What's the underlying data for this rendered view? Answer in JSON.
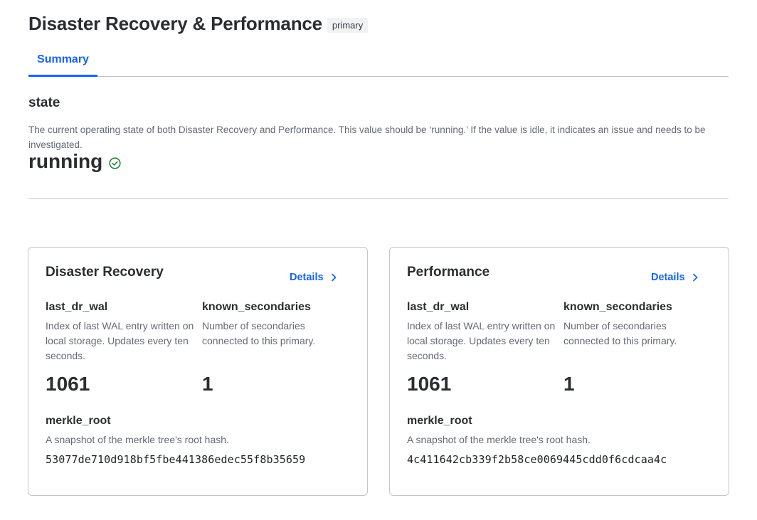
{
  "header": {
    "title": "Disaster Recovery & Performance",
    "badge": "primary"
  },
  "tabs": [
    {
      "label": "Summary",
      "active": true
    }
  ],
  "state": {
    "title": "state",
    "description": "The current operating state of both Disaster Recovery and Performance. This value should be ‘running.’ If the value is idle, it indicates an issue and needs to be investigated.",
    "value": "running",
    "status_icon": "check-circle-icon",
    "status_color": "#1d8a3a"
  },
  "colors": {
    "accent": "#1563ff",
    "text_muted": "#656a76",
    "border": "#c2c5cb"
  },
  "cards": [
    {
      "title": "Disaster Recovery",
      "details_label": "Details",
      "last_wal": {
        "label": "last_dr_wal",
        "description": "Index of last WAL entry written on local storage. Updates every ten seconds.",
        "value": "1061"
      },
      "secondaries": {
        "label": "known_secondaries",
        "description": "Number of secondaries connected to this primary.",
        "value": "1"
      },
      "merkle": {
        "label": "merkle_root",
        "description": "A snapshot of the merkle tree's root hash.",
        "value": "53077de710d918bf5fbe441386edec55f8b35659"
      }
    },
    {
      "title": "Performance",
      "details_label": "Details",
      "last_wal": {
        "label": "last_dr_wal",
        "description": "Index of last WAL entry written on local storage. Updates every ten seconds.",
        "value": "1061"
      },
      "secondaries": {
        "label": "known_secondaries",
        "description": "Number of secondaries connected to this primary.",
        "value": "1"
      },
      "merkle": {
        "label": "merkle_root",
        "description": "A snapshot of the merkle tree's root hash.",
        "value": "4c411642cb339f2b58ce0069445cdd0f6cdcaa4c"
      }
    }
  ]
}
